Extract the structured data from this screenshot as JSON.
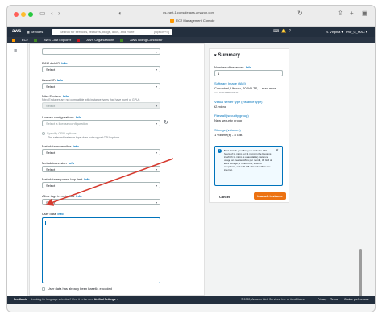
{
  "browser": {
    "url": "us-east-1.console.aws.amazon.com",
    "tab_title": "EC2 Management Console"
  },
  "aws_nav": {
    "logo": "aws",
    "services": "Services",
    "search_placeholder": "Search for services, features, blogs, docs, and more",
    "search_shortcut": "[Option+S]",
    "region": "N. Virginia",
    "account": "Prof_G_MAC"
  },
  "favorites": [
    "EC2",
    "AWS Cost Explorer",
    "AWS Organizations",
    "AWS Billing Conductor"
  ],
  "form": {
    "ram_disk_label": "RAM disk ID",
    "kernel_id_label": "Kernel ID",
    "nitro_label": "Nitro Enclave",
    "nitro_help": "Nitro Enclaves are not compatible with instance types that have burst or GPUs",
    "license_label": "License configurations",
    "license_placeholder": "Select a license configuration",
    "specify_cpu": "Specify CPU options",
    "specify_cpu_help": "The selected instance type does not support CPU options",
    "metadata_accessible_label": "Metadata accessible",
    "metadata_version_label": "Metadata version",
    "metadata_hop_label": "Metadata response hop limit",
    "allow_tags_label": "Allow tags in metadata",
    "user_data_label": "User data",
    "encoded_label": "User data has already been base64 encoded",
    "select": "Select",
    "info": "Info"
  },
  "summary": {
    "title": "Summary",
    "num_instances_label": "Number of instances",
    "num_instances_value": "1",
    "ami_link": "Software Image (AMI)",
    "ami_value": "Canonical, Ubuntu, 20.04 LTS, ...read more",
    "ami_id": "ami-0c5b2df6f0c9f8d1c",
    "instance_type_link": "Virtual server type (instance type)",
    "instance_type_value": "t2.micro",
    "firewall_link": "Firewall (security group)",
    "firewall_value": "New security group",
    "storage_link": "Storage (volumes)",
    "storage_value": "1 volume(s) - 8 GiB",
    "free_tier_bold": "Free tier:",
    "free_tier_text": "In your first year includes 750 hours of t2.micro (or t3.micro in the Regions in which t2.micro is unavailable) instance usage on free tier AMIs per month, 30 GiB of EBS storage, 2 million IOs, 1 GB of snapshots, and 100 GB of bandwidth to the internet.",
    "cancel": "Cancel",
    "launch": "Launch instance"
  },
  "footer": {
    "feedback": "Feedback",
    "lang_prefix": "Looking for language selection? Find it in the new",
    "lang_link": "Unified Settings",
    "copyright": "© 2022, Amazon Web Services, Inc. or its affiliates.",
    "privacy": "Privacy",
    "terms": "Terms",
    "cookies": "Cookie preferences"
  },
  "colors": {
    "aws_nav": "#232f3e",
    "link": "#0073bb",
    "launch_button": "#ec7211",
    "annotation_arrow": "#d63a2f"
  }
}
